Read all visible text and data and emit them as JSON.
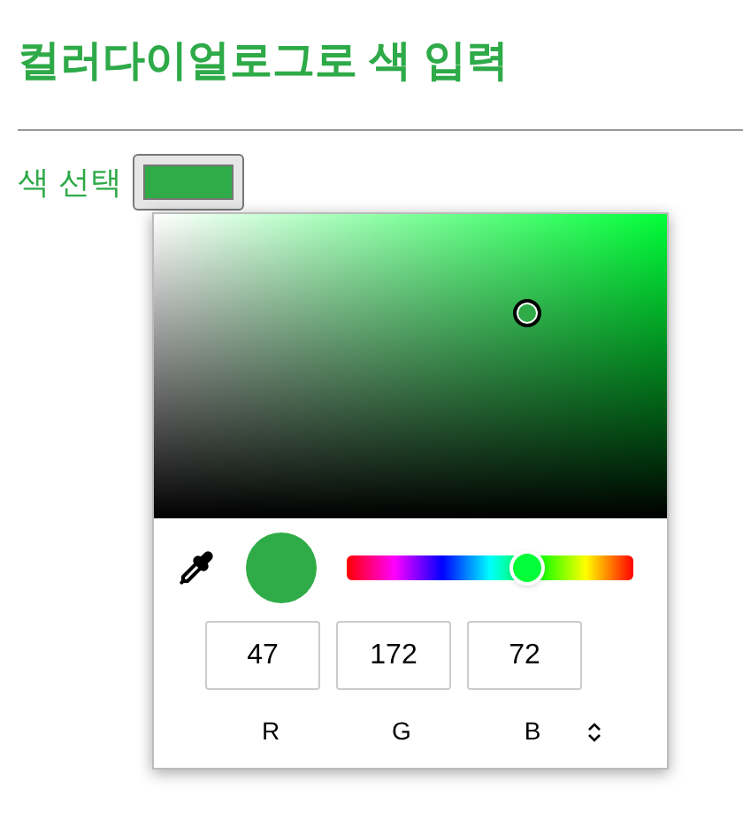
{
  "heading": "컬러다이얼로그로 색 입력",
  "color_label": "색 선택",
  "picker": {
    "hue_slider": {
      "level": 0.63
    },
    "channels": [
      {
        "label": "R",
        "value": "47"
      },
      {
        "label": "G",
        "value": "172"
      },
      {
        "label": "B",
        "value": "72"
      }
    ]
  }
}
